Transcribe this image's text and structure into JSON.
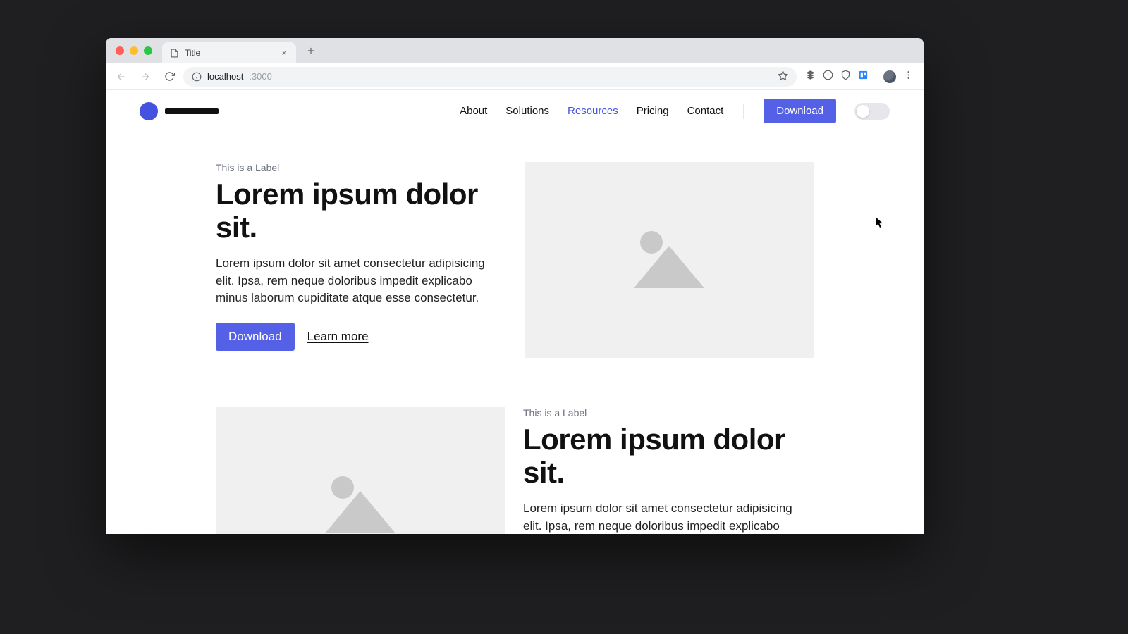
{
  "browser": {
    "tab_title": "Title",
    "url_host": "localhost",
    "url_port": ":3000"
  },
  "site": {
    "nav": {
      "about": "About",
      "solutions": "Solutions",
      "resources": "Resources",
      "pricing": "Pricing",
      "contact": "Contact",
      "download": "Download"
    }
  },
  "sections": [
    {
      "label": "This is a Label",
      "headline": "Lorem ipsum dolor sit.",
      "body": "Lorem ipsum dolor sit amet consectetur adipisicing elit. Ipsa, rem neque doloribus impedit explicabo minus laborum cupiditate atque esse consectetur.",
      "cta_primary": "Download",
      "cta_secondary": "Learn more"
    },
    {
      "label": "This is a Label",
      "headline": "Lorem ipsum dolor sit.",
      "body": "Lorem ipsum dolor sit amet consectetur adipisicing elit. Ipsa, rem neque doloribus impedit explicabo minus"
    }
  ]
}
